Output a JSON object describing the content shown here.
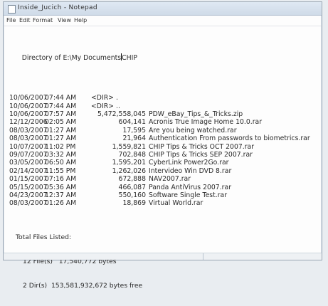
{
  "window": {
    "title": "Inside_Jucich - Notepad"
  },
  "menu": [
    "File",
    "Edit",
    "Format",
    "View",
    "Help"
  ],
  "directory_line": {
    "prefix": "Directory of E:\\My Documents",
    "suffix": "CHIP"
  },
  "rows": [
    {
      "date": "10/06/2007",
      "time": "07:44 AM",
      "size": "",
      "dir": "<DIR>",
      "name": "."
    },
    {
      "date": "10/06/2007",
      "time": "07:44 AM",
      "size": "",
      "dir": "<DIR>",
      "name": ".."
    },
    {
      "date": "10/06/2007",
      "time": "07:57 AM",
      "size": "5,472,558,045",
      "dir": "",
      "name": "PDW_eBay_Tips_&_Tricks.zip"
    },
    {
      "date": "12/12/2006",
      "time": "02:05 AM",
      "size": "604,141",
      "dir": "",
      "name": "Acronis True Image Home 10.0.rar"
    },
    {
      "date": "08/03/2007",
      "time": "01:27 AM",
      "size": "17,595",
      "dir": "",
      "name": "Are you being watched.rar"
    },
    {
      "date": "08/03/2007",
      "time": "01:27 AM",
      "size": "21,964",
      "dir": "",
      "name": "Authentication From passwords to biometrics.rar"
    },
    {
      "date": "10/07/2007",
      "time": "11:02 PM",
      "size": "1,559,821",
      "dir": "",
      "name": "CHIP Tips & Tricks OCT 2007.rar"
    },
    {
      "date": "09/07/2007",
      "time": "03:32 AM",
      "size": "702,848",
      "dir": "",
      "name": "CHIP Tips & Tricks SEP 2007.rar"
    },
    {
      "date": "03/05/2007",
      "time": "06:50 AM",
      "size": "1,595,201",
      "dir": "",
      "name": "CyberLink Power2Go.rar"
    },
    {
      "date": "02/14/2007",
      "time": "11:55 PM",
      "size": "1,262,026",
      "dir": "",
      "name": "Intervideo Win DVD 8.rar"
    },
    {
      "date": "01/15/2007",
      "time": "07:16 AM",
      "size": "672,888",
      "dir": "",
      "name": "NAV2007.rar"
    },
    {
      "date": "05/15/2007",
      "time": "05:36 AM",
      "size": "466,087",
      "dir": "",
      "name": "Panda AntiVirus 2007.rar"
    },
    {
      "date": "04/23/2007",
      "time": "12:37 AM",
      "size": "550,160",
      "dir": "",
      "name": "Software Single Test.rar"
    },
    {
      "date": "08/03/2007",
      "time": "01:26 AM",
      "size": "18,869",
      "dir": "",
      "name": "Virtual World.rar"
    }
  ],
  "summary": {
    "heading": "Total Files Listed:",
    "files_line": "12 File(s)   17,540,772 bytes",
    "dirs_line": "2 Dir(s)  153,581,932,672 bytes free"
  }
}
